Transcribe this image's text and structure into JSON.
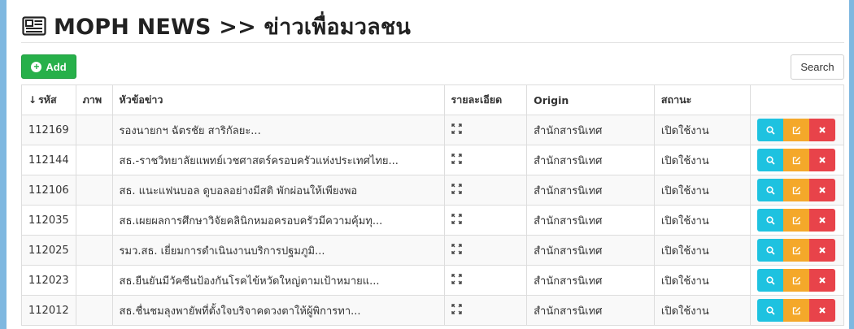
{
  "header": {
    "title": "MOPH NEWS >> ข่าวเพื่อมวลชน",
    "icon": "newspaper-icon"
  },
  "toolbar": {
    "add_label": "Add",
    "search_label": "Search"
  },
  "table": {
    "columns": [
      "รหัส",
      "ภาพ",
      "หัวข้อข่าว",
      "รายละเอียด",
      "Origin",
      "สถานะ",
      ""
    ],
    "sort_indicator": "↓",
    "rows": [
      {
        "id": "112169",
        "image": "",
        "title": "รองนายกฯ ฉัตรชัย สาริกัลยะ...",
        "origin": "สำนักสารนิเทศ",
        "status": "เปิดใช้งาน"
      },
      {
        "id": "112144",
        "image": "",
        "title": "สธ.-ราชวิทยาลัยแพทย์เวชศาสตร์ครอบครัวแห่งประเทศไทย...",
        "origin": "สำนักสารนิเทศ",
        "status": "เปิดใช้งาน"
      },
      {
        "id": "112106",
        "image": "",
        "title": "สธ. แนะแฟนบอล ดูบอลอย่างมีสติ พักผ่อนให้เพียงพอ",
        "origin": "สำนักสารนิเทศ",
        "status": "เปิดใช้งาน"
      },
      {
        "id": "112035",
        "image": "",
        "title": "สธ.เผยผลการศึกษาวิจัยคลินิกหมอครอบครัวมีความคุ้มทุ...",
        "origin": "สำนักสารนิเทศ",
        "status": "เปิดใช้งาน"
      },
      {
        "id": "112025",
        "image": "",
        "title": "รมว.สธ. เยี่ยมการดำเนินงานบริการปฐมภูมิ...",
        "origin": "สำนักสารนิเทศ",
        "status": "เปิดใช้งาน"
      },
      {
        "id": "112023",
        "image": "",
        "title": "สธ.ยืนยันมีวัคซีนป้องกันโรคไข้หวัดใหญ่ตามเป้าหมายแ...",
        "origin": "สำนักสารนิเทศ",
        "status": "เปิดใช้งาน"
      },
      {
        "id": "112012",
        "image": "",
        "title": "สธ.ชื่นชมลุงพายัพที่ตั้งใจบริจาคดวงตาให้ผู้พิการทา...",
        "origin": "สำนักสารนิเทศ",
        "status": "เปิดใช้งาน"
      }
    ]
  },
  "colors": {
    "add": "#27b04a",
    "view": "#1ec2e0",
    "edit": "#f4a82a",
    "delete": "#e8434a"
  }
}
